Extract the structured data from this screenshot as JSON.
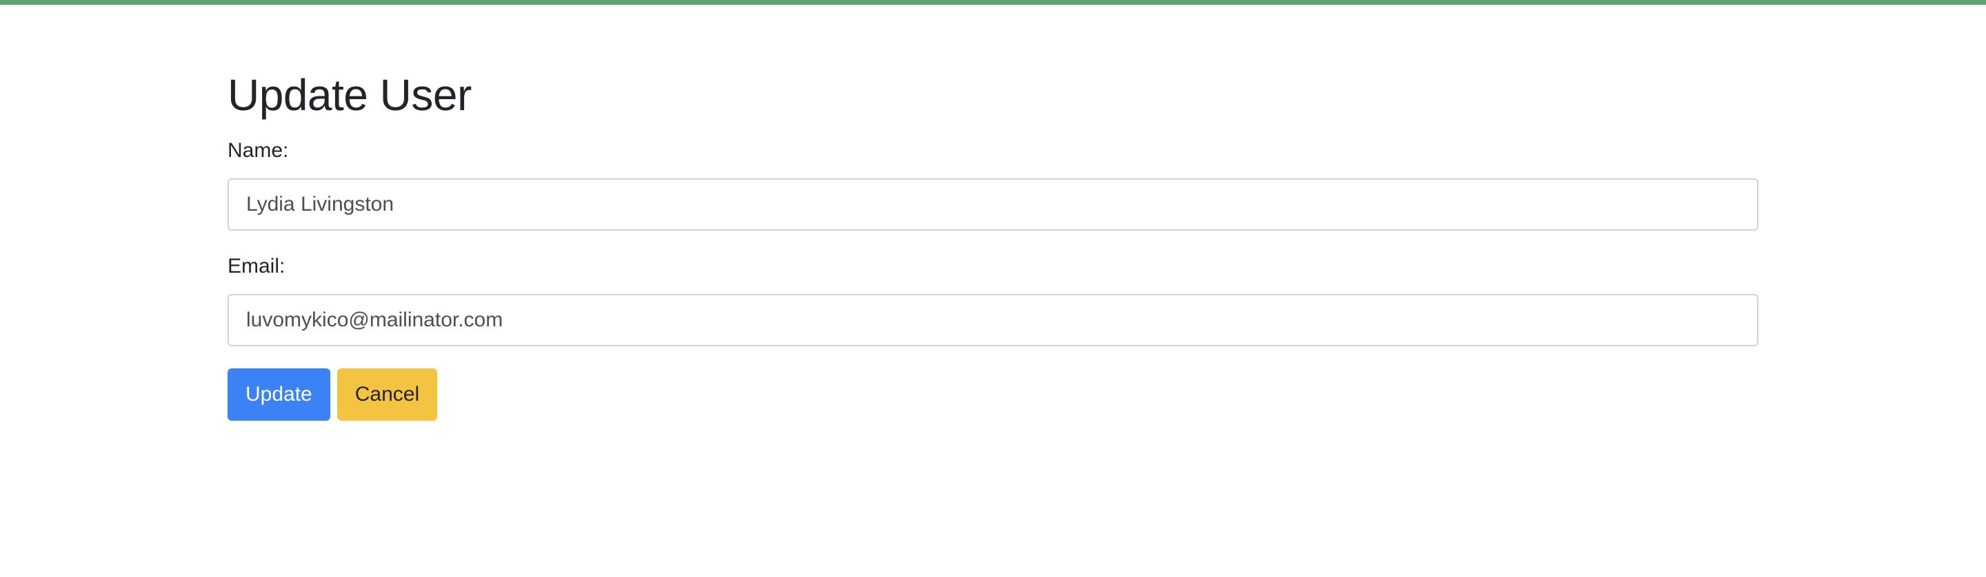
{
  "colors": {
    "top_bar": "#5fa874",
    "primary_button": "#3b82f6",
    "warning_button": "#f4c341",
    "input_border": "#ced4da"
  },
  "page": {
    "title": "Update User"
  },
  "form": {
    "name": {
      "label": "Name:",
      "value": "Lydia Livingston"
    },
    "email": {
      "label": "Email:",
      "value": "luvomykico@mailinator.com"
    }
  },
  "buttons": {
    "update_label": "Update",
    "cancel_label": "Cancel"
  }
}
